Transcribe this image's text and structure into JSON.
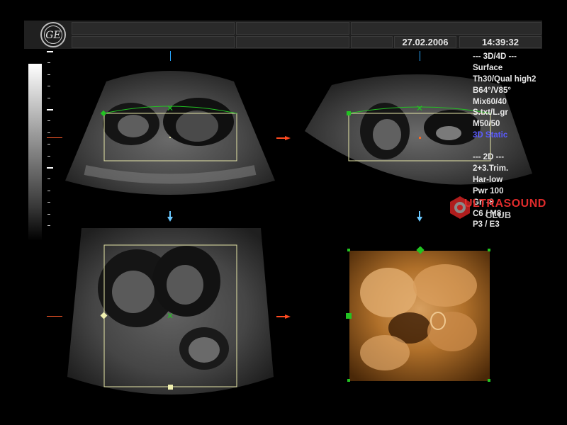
{
  "header": {
    "logo_icon": "ge-logo-icon",
    "date": "27.02.2006",
    "time": "14:39:32"
  },
  "info_panel": {
    "lines_3d": [
      "--- 3D/4D ---",
      "Surface",
      "Th30/Qual high2",
      "B64°/V85°",
      "Mix60/40",
      "S.txt/L.gr",
      "M50/50"
    ],
    "mode_highlight": "3D Static",
    "lines_2d": [
      "--- 2D ---",
      "2+3.Trim.",
      "Har-low",
      "Pwr 100",
      "Gn -8",
      "C6 / M8",
      "P3 / E3"
    ]
  },
  "watermark": {
    "text": "ULTRASOUND",
    "sub": "CLUB"
  },
  "colors": {
    "roi_box": "#e6e6a8",
    "render_curve": "#22c322",
    "marker_orange": "#ff4a20",
    "marker_blue": "#2aa8ff",
    "render_tone": "#b0702a",
    "highlight_blue": "#5a5aff"
  }
}
